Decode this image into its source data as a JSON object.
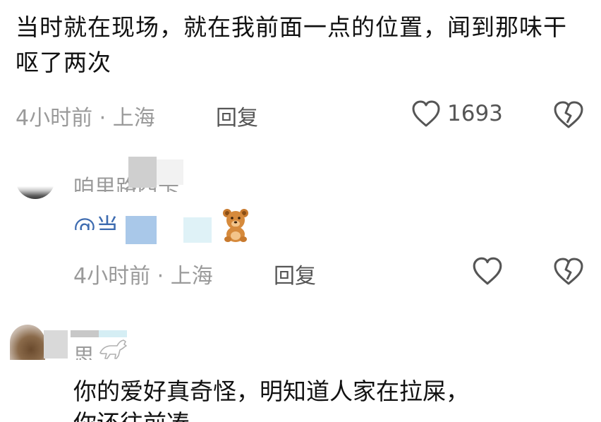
{
  "comment1": {
    "text": "当时就在现场，就在我前面一点的位置，闻到那味干呕了两次",
    "time_location": "4小时前 · 上海",
    "reply_label": "回复",
    "like_count": "1693"
  },
  "comment2": {
    "username": "咱里路西卡",
    "mention": "@当 牙",
    "emoji": "bear",
    "time_location": "4小时前 · 上海",
    "reply_label": "回复"
  },
  "comment3": {
    "username": "思",
    "text": "你的爱好真奇怪，明知道人家在拉屎，",
    "text_next": "你还往前凑"
  },
  "colors": {
    "text": "#111111",
    "meta": "#9a9a9a",
    "icon": "#555555",
    "mention": "#3d6bb0"
  }
}
